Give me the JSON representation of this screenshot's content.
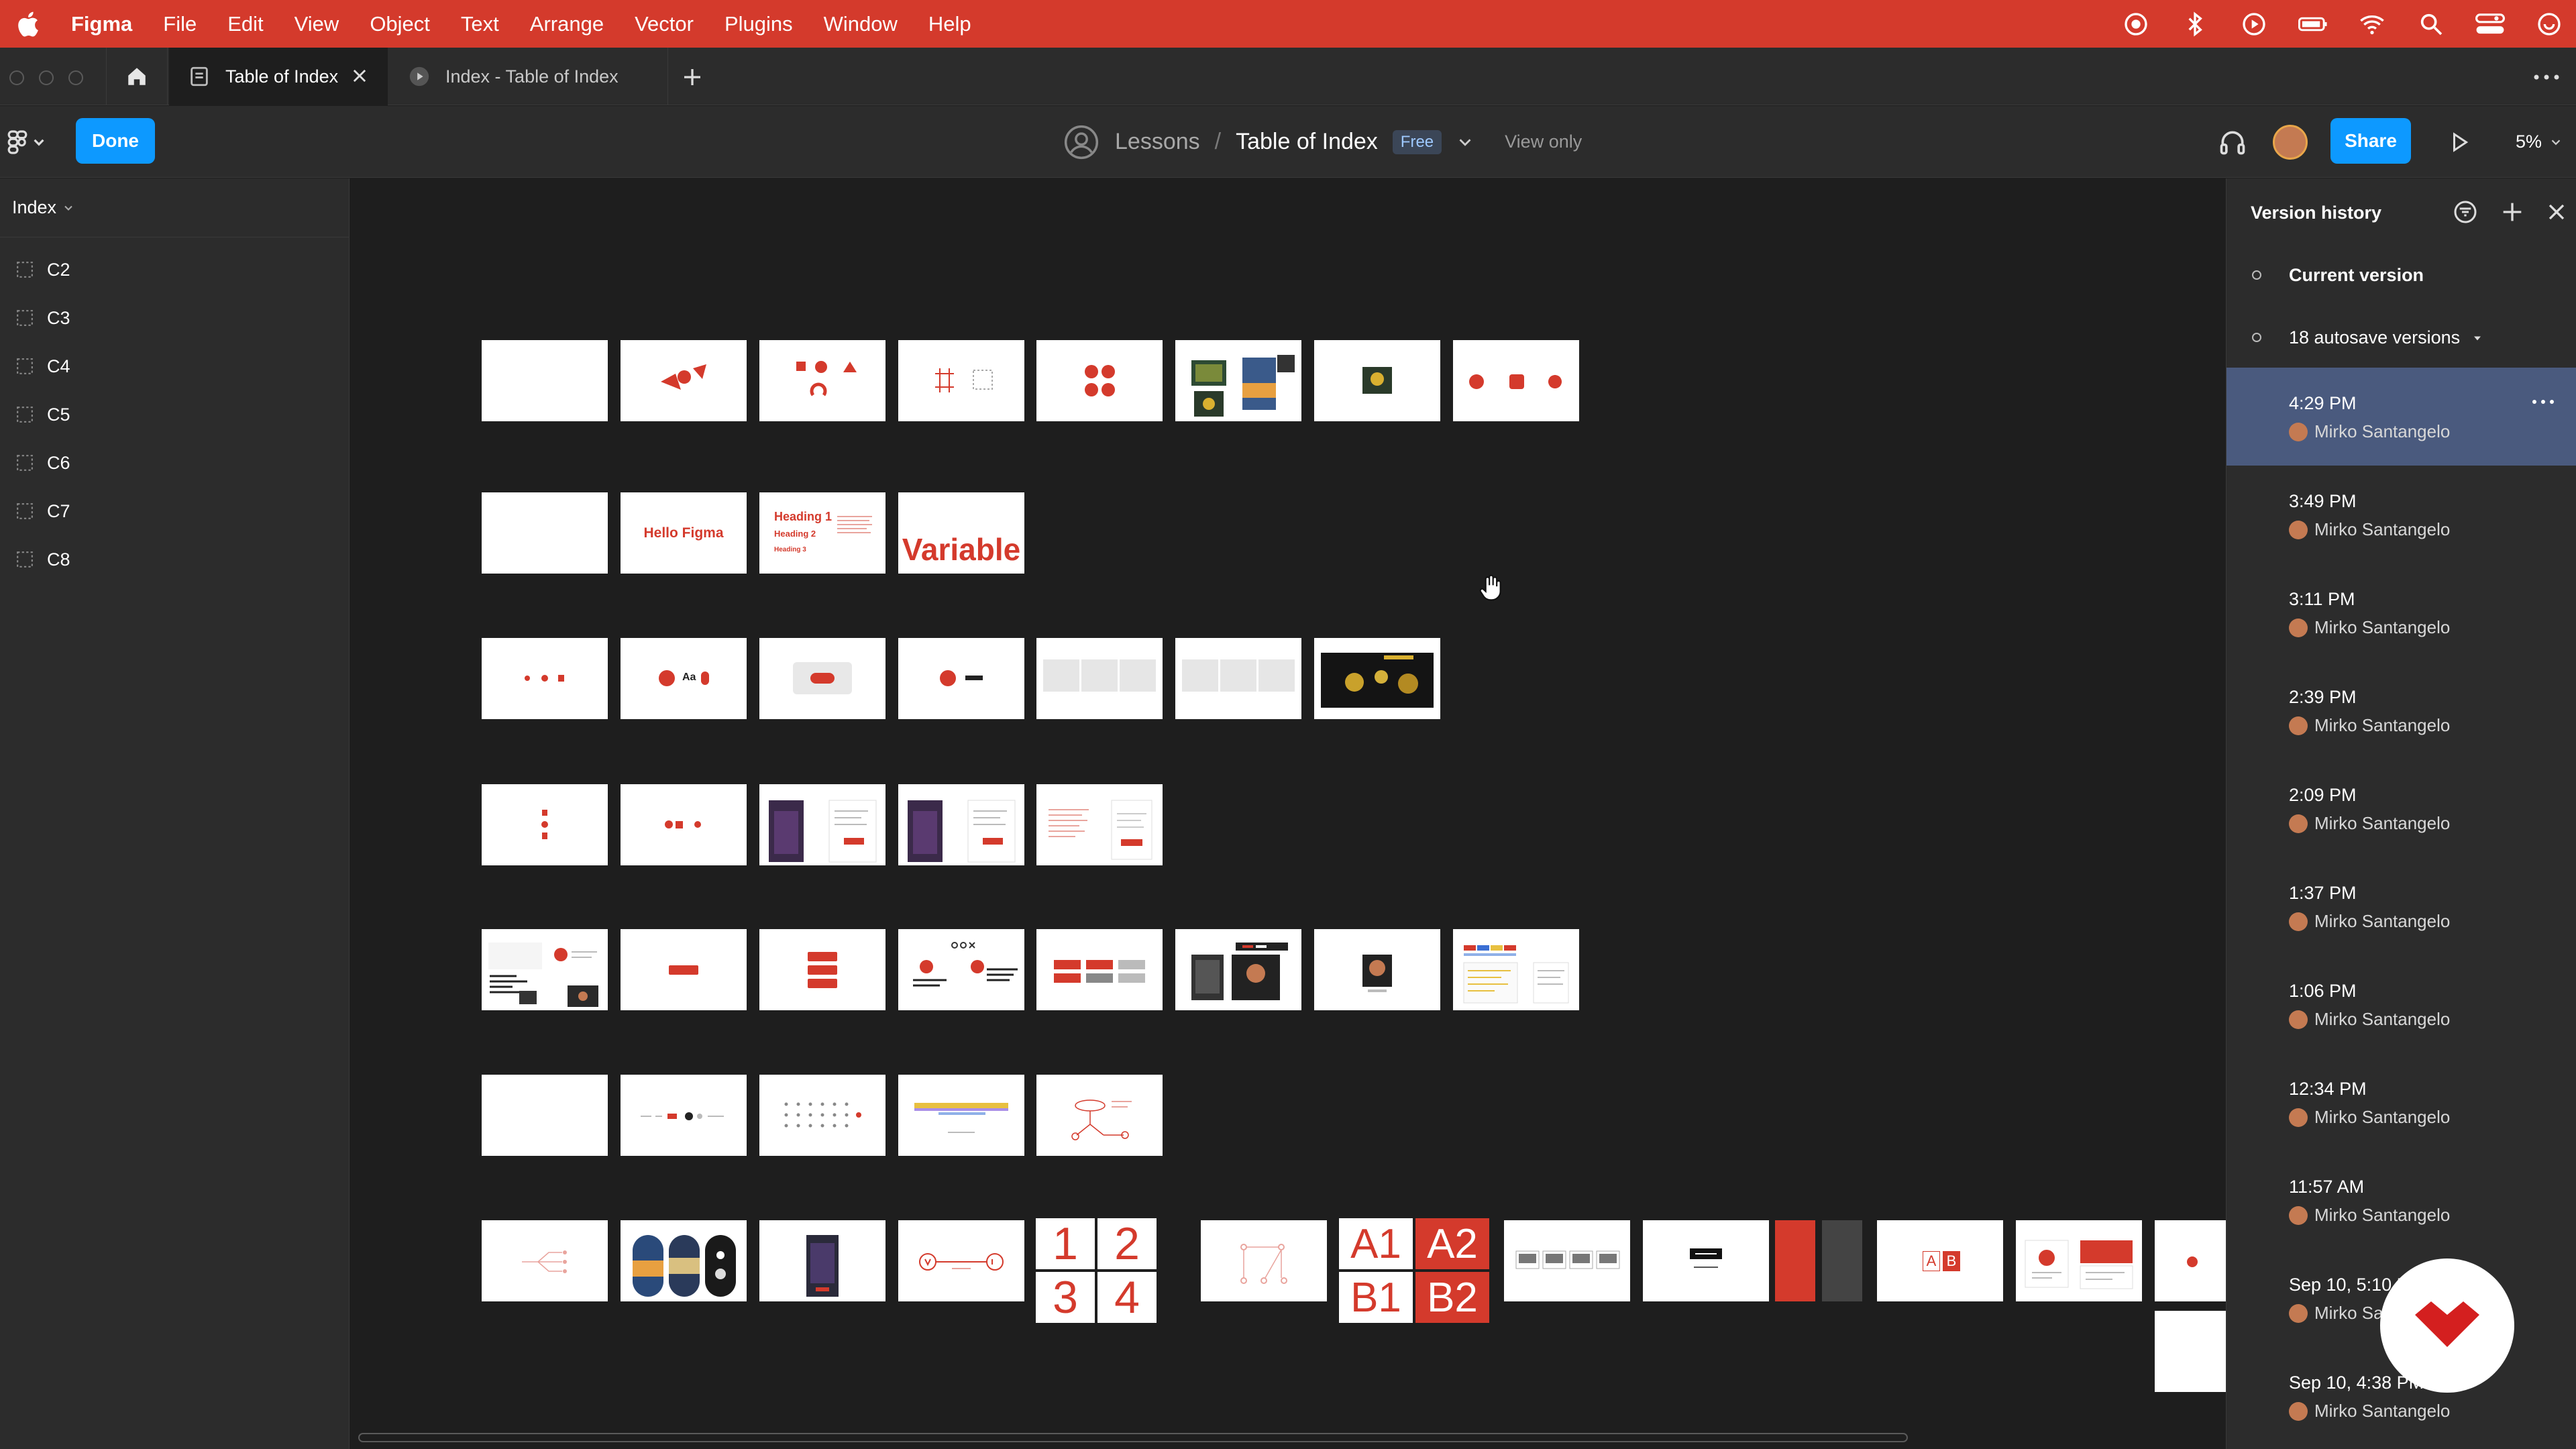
{
  "menubar": {
    "app": "Figma",
    "items": [
      "File",
      "Edit",
      "View",
      "Object",
      "Text",
      "Arrange",
      "Vector",
      "Plugins",
      "Window",
      "Help"
    ]
  },
  "tabs": [
    {
      "label": "Table of Index",
      "active": true
    },
    {
      "label": "Index - Table of Index",
      "active": false
    }
  ],
  "toolbar": {
    "done_label": "Done",
    "project": "Lessons",
    "separator": "/",
    "file_name": "Table of Index",
    "plan_badge": "Free",
    "mode": "View only",
    "share_label": "Share",
    "zoom": "5%"
  },
  "left_panel": {
    "page": "Index",
    "layers": [
      "C2",
      "C3",
      "C4",
      "C5",
      "C6",
      "C7",
      "C8"
    ]
  },
  "canvas": {
    "texts": {
      "hello": "Hello Figma",
      "h1": "Heading 1",
      "h2": "Heading 2",
      "h3": "Heading 3",
      "variable": "Variable",
      "aa": "Aa",
      "n1": "1",
      "n2": "2",
      "n3": "3",
      "n4": "4",
      "a1": "A1",
      "a2": "A2",
      "b1": "B1",
      "b2": "B2",
      "a": "A",
      "b": "B"
    }
  },
  "version_history": {
    "title": "Version history",
    "current": "Current version",
    "autosave": "18 autosave versions",
    "versions": [
      {
        "time": "4:29 PM",
        "author": "Mirko Santangelo",
        "selected": true
      },
      {
        "time": "3:49 PM",
        "author": "Mirko Santangelo"
      },
      {
        "time": "3:11 PM",
        "author": "Mirko Santangelo"
      },
      {
        "time": "2:39 PM",
        "author": "Mirko Santangelo"
      },
      {
        "time": "2:09 PM",
        "author": "Mirko Santangelo"
      },
      {
        "time": "1:37 PM",
        "author": "Mirko Santangelo"
      },
      {
        "time": "1:06 PM",
        "author": "Mirko Santangelo"
      },
      {
        "time": "12:34 PM",
        "author": "Mirko Santangelo"
      },
      {
        "time": "11:57 AM",
        "author": "Mirko Santangelo"
      },
      {
        "time": "Sep 10, 5:10 PM",
        "author": "Mirko Santangelo"
      },
      {
        "time": "Sep 10, 4:38 PM",
        "author": "Mirko Santangelo"
      }
    ]
  },
  "colors": {
    "accent": "#d43a2c",
    "primary_button": "#0d99ff",
    "selected_row": "#4a5a7e"
  }
}
